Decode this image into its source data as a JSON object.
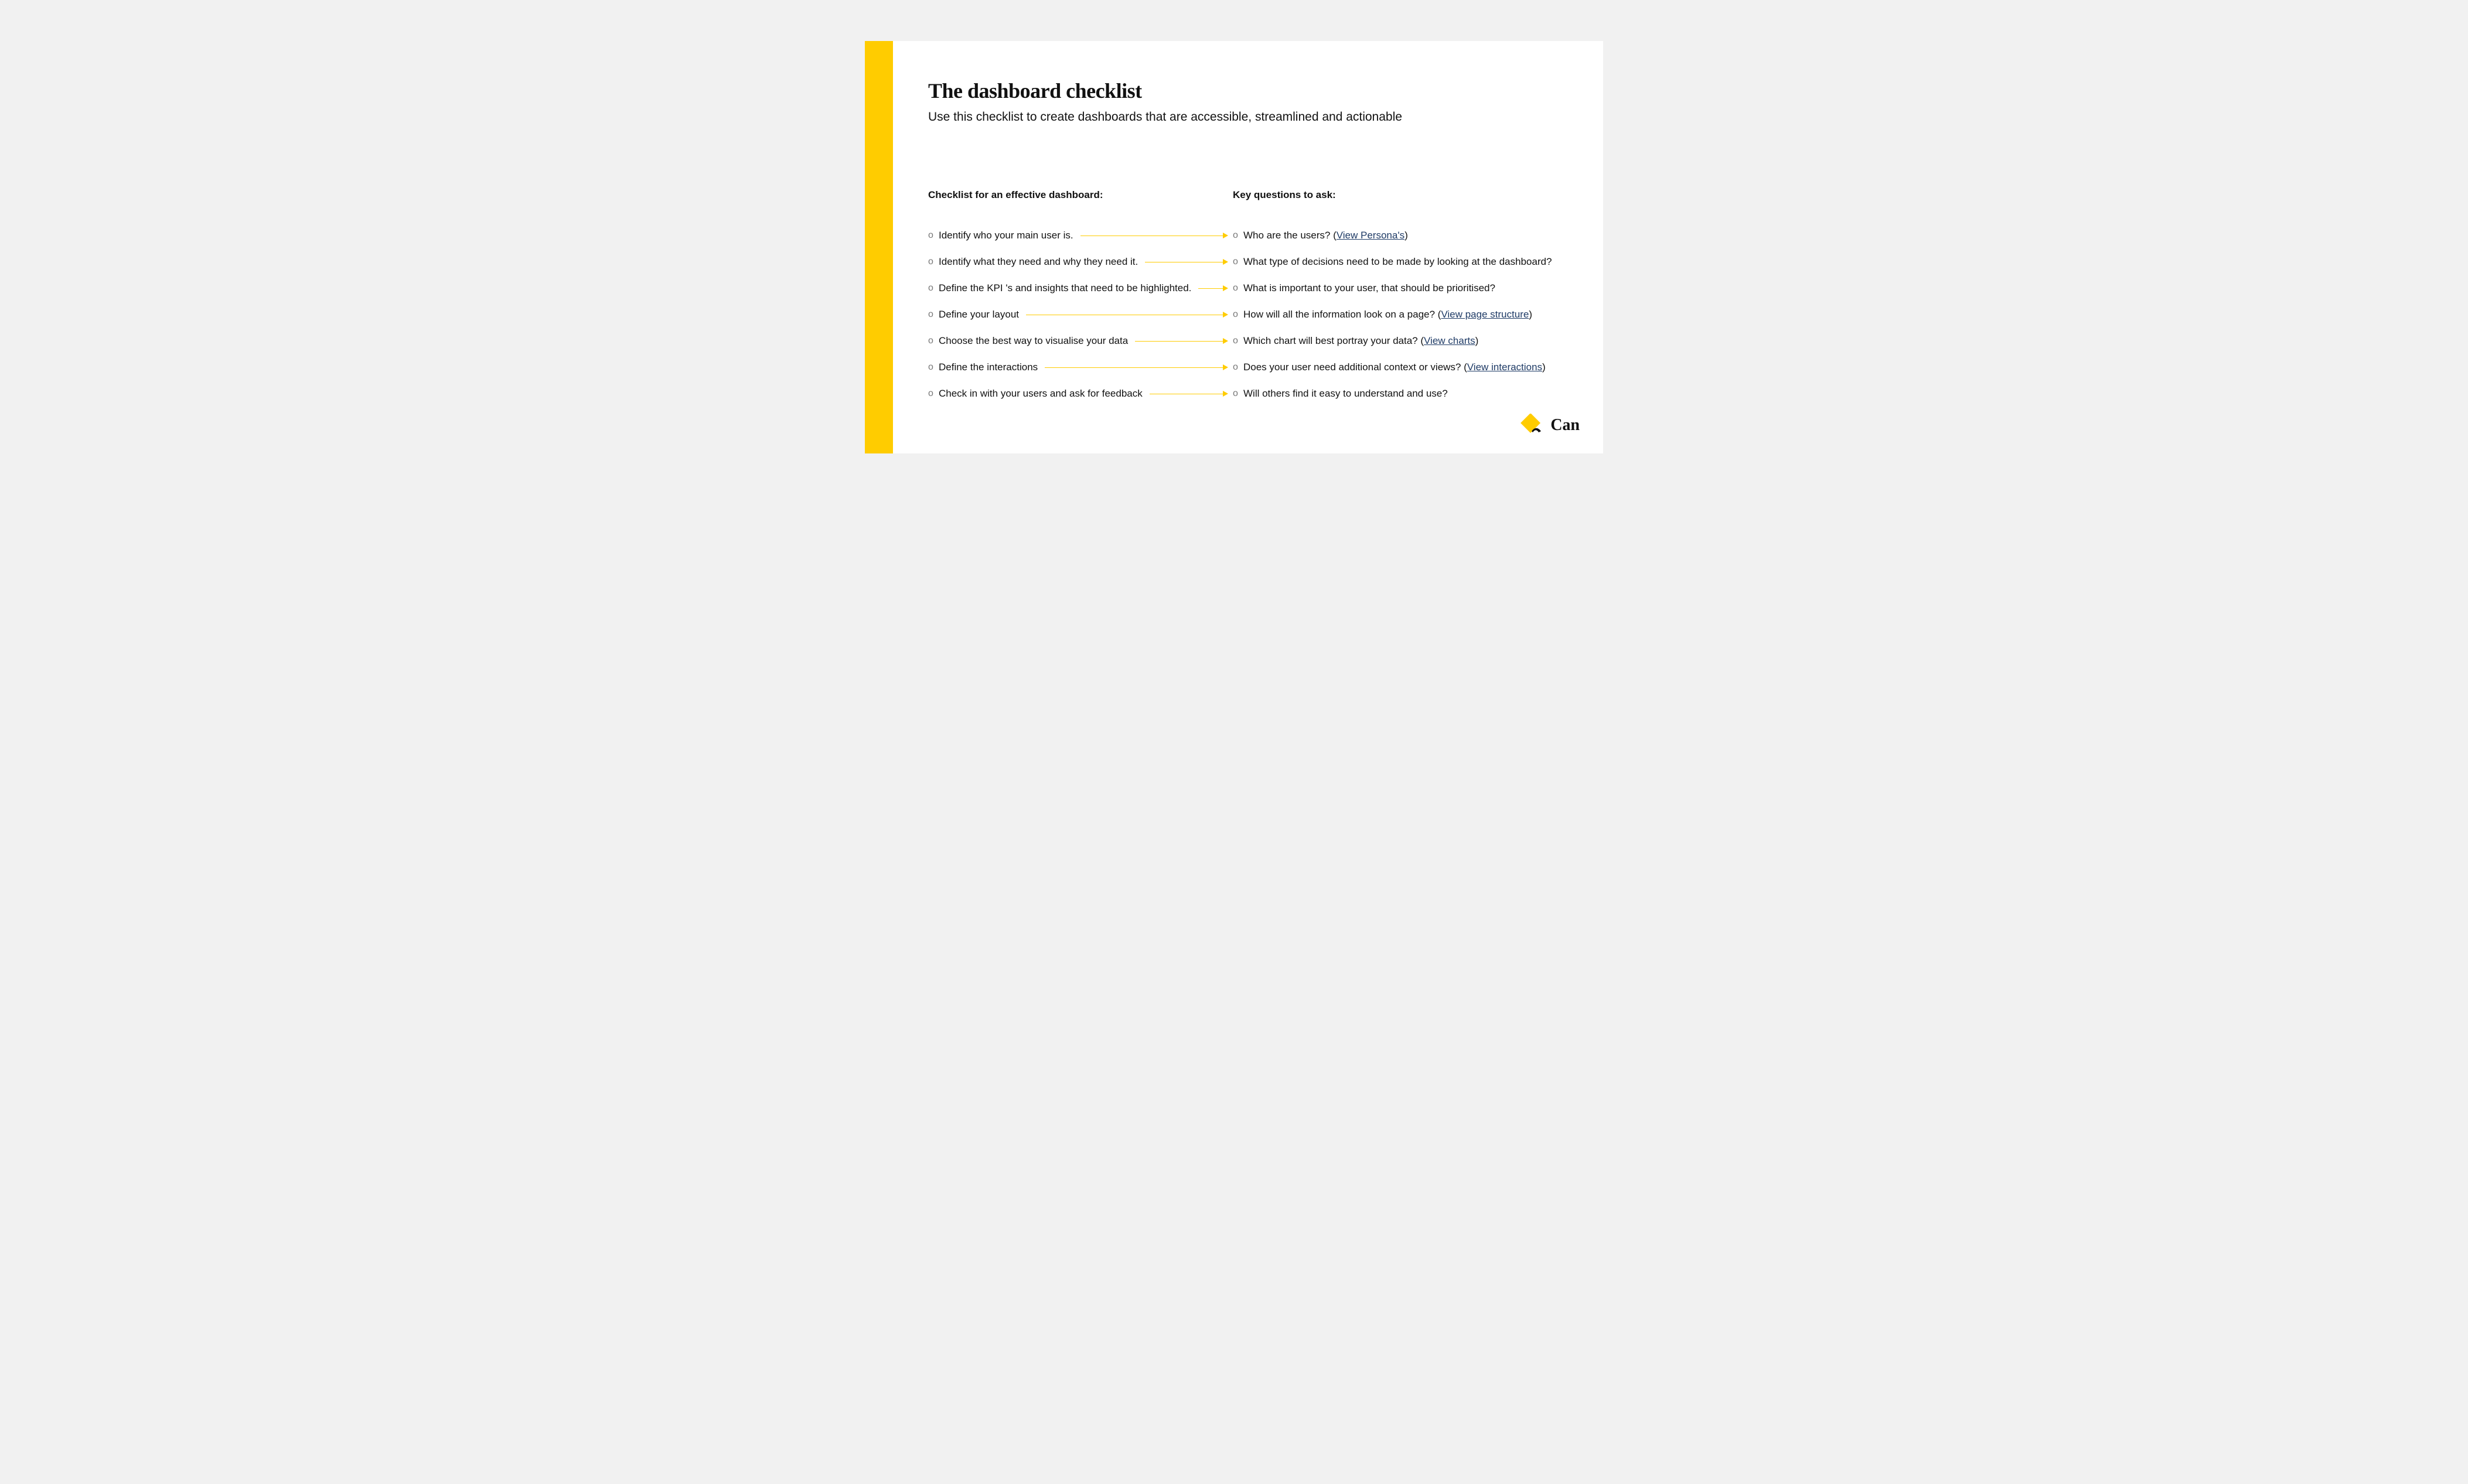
{
  "header": {
    "title": "The dashboard checklist",
    "subtitle": "Use this checklist to create dashboards that are accessible, streamlined and actionable"
  },
  "columns": {
    "left_heading": "Checklist for an effective dashboard:",
    "right_heading": "Key questions to ask:"
  },
  "rows": [
    {
      "left": "Identify who your main user is.",
      "right_pre": "Who are the users?  (",
      "link": "View Persona's",
      "right_post": ")"
    },
    {
      "left": "Identify what they need and why they need it.",
      "right_pre": "What type of decisions need to be made by looking at the dashboard?",
      "link": "",
      "right_post": ""
    },
    {
      "left": "Define the KPI 's and insights that need to be highlighted.",
      "right_pre": "What is important to your user, that should be prioritised?",
      "link": "",
      "right_post": ""
    },
    {
      "left": "Define your layout",
      "right_pre": "How will all the information look on a page? (",
      "link": "View page structure",
      "right_post": ")"
    },
    {
      "left": "Choose the best way to visualise your data",
      "right_pre": "Which chart will best portray your data? (",
      "link": "View charts",
      "right_post": ")"
    },
    {
      "left": "Define the interactions",
      "right_pre": "Does your user need additional context or views? (",
      "link": "View interactions",
      "right_post": ")"
    },
    {
      "left": "Check in with your users and ask for feedback",
      "right_pre": "Will others find it easy to understand and use?",
      "link": "",
      "right_post": ""
    }
  ],
  "brand": {
    "text": "Can",
    "colors": {
      "diamond": "#ffcc00",
      "tick": "#111111"
    }
  }
}
